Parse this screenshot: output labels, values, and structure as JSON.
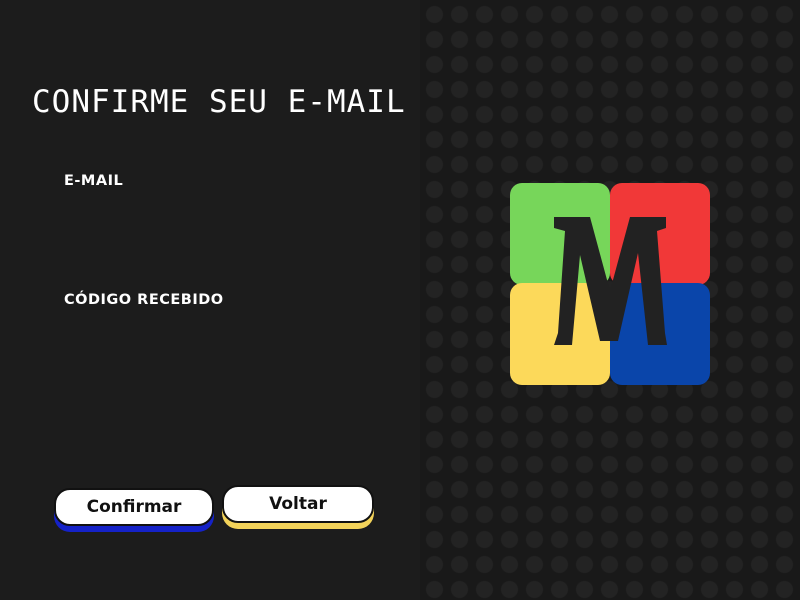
{
  "page": {
    "title": "CONFIRME SEU E-MAIL"
  },
  "form": {
    "email_label": "E-MAIL",
    "email_value": "",
    "code_label": "CÓDIGO RECEBIDO",
    "code_value": ""
  },
  "buttons": {
    "confirm_label": "Confirmar",
    "back_label": "Voltar"
  },
  "logo": {
    "letter": "M",
    "colors": {
      "green": "#77d65a",
      "red": "#f13838",
      "yellow": "#fcd95a",
      "blue": "#0a45aa",
      "letter": "#222222"
    }
  },
  "colors": {
    "background": "#1c1c1c",
    "confirm_shadow": "#1522c8",
    "back_shadow": "#f3d35a"
  }
}
